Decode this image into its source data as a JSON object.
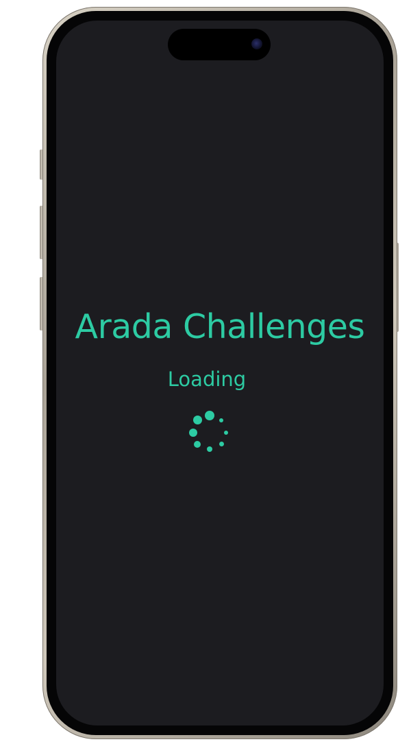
{
  "app": {
    "title": "Arada Challenges",
    "loading_label": "Loading"
  },
  "spinner": {
    "icon": "loading-spinner-icon",
    "dot_count": 8,
    "color": "#2dcba3"
  },
  "colors": {
    "accent": "#2dcba3",
    "screen_background": "#1c1c20"
  }
}
